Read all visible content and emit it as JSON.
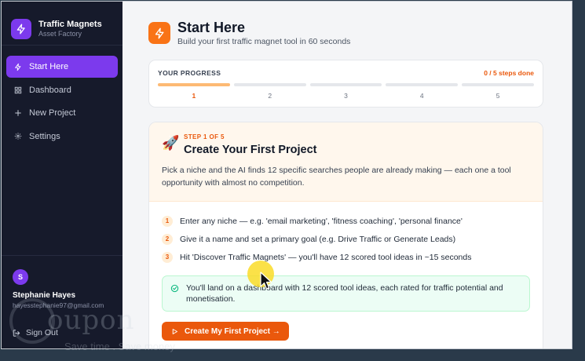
{
  "brand": {
    "title": "Traffic Magnets",
    "subtitle": "Asset Factory"
  },
  "nav": [
    {
      "label": "Start Here",
      "icon": "bolt-icon",
      "active": true
    },
    {
      "label": "Dashboard",
      "icon": "grid-icon",
      "active": false
    },
    {
      "label": "New Project",
      "icon": "plus-icon",
      "active": false
    },
    {
      "label": "Settings",
      "icon": "gear-icon",
      "active": false
    }
  ],
  "user": {
    "initial": "S",
    "name": "Stephanie Hayes",
    "email": "hayesstephanie97@gmail.com",
    "signout_label": "Sign Out"
  },
  "page": {
    "title": "Start Here",
    "subtitle": "Build your first traffic magnet tool in 60 seconds"
  },
  "progress": {
    "label": "YOUR PROGRESS",
    "count": "0 / 5 steps done",
    "steps": [
      "1",
      "2",
      "3",
      "4",
      "5"
    ],
    "current_index": 0
  },
  "step": {
    "kicker": "STEP 1 OF 5",
    "title": "Create Your First Project",
    "description": "Pick a niche and the AI finds 12 specific searches people are already making — each one a tool opportunity with almost no competition.",
    "items": [
      {
        "num": "1",
        "text": "Enter any niche — e.g. 'email marketing', 'fitness coaching', 'personal finance'"
      },
      {
        "num": "2",
        "text": "Give it a name and set a primary goal (e.g. Drive Traffic or Generate Leads)"
      },
      {
        "num": "3",
        "text": "Hit 'Discover Traffic Magnets' — you'll have 12 scored tool ideas in ~15 seconds"
      }
    ],
    "notice": "You'll land on a dashboard with 12 scored tool ideas, each rated for traffic potential and monetisation.",
    "cta_label": "Create My First Project →"
  },
  "watermark": {
    "text": "oupon",
    "sub": "Save time . Save money"
  },
  "colors": {
    "accent_purple": "#7c3aed",
    "accent_orange": "#ea580c",
    "sidebar_bg": "#161a2b"
  }
}
